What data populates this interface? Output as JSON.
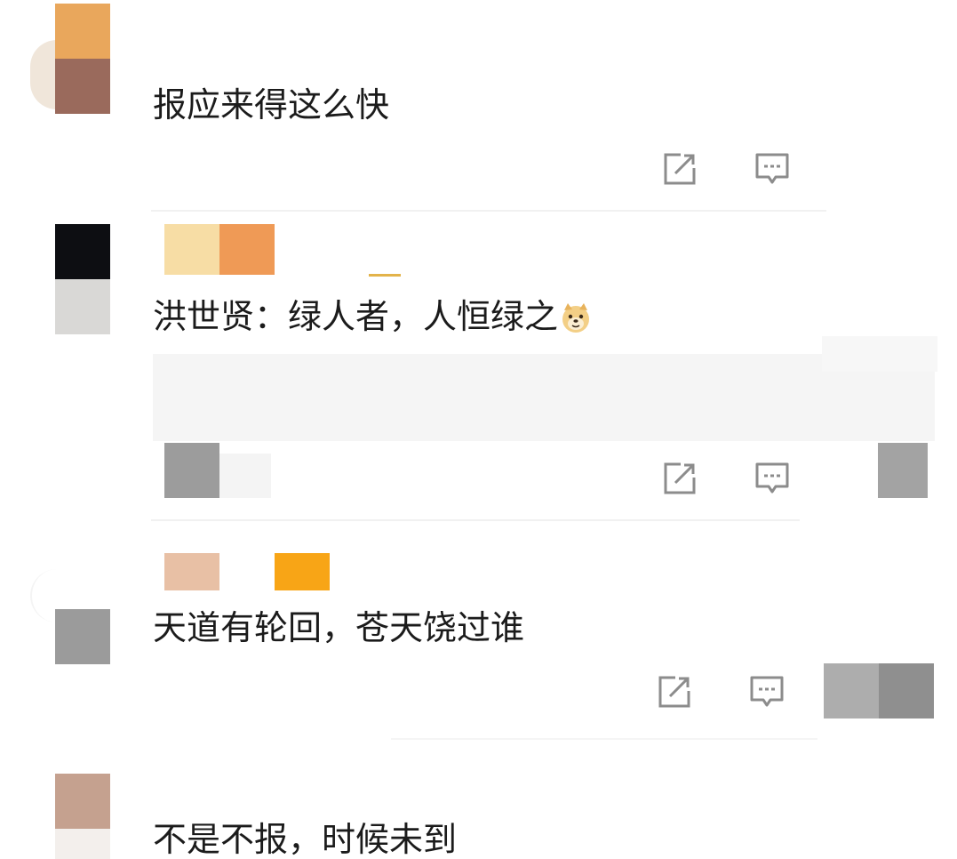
{
  "comments": [
    {
      "text": "报应来得这么快",
      "actions": {
        "share_icon": "share-icon",
        "reply_icon": "comment-icon"
      }
    },
    {
      "text": "洪世贤：绿人者，人恒绿之",
      "emoji": "doge-emoji",
      "actions": {
        "share_icon": "share-icon",
        "reply_icon": "comment-icon"
      }
    },
    {
      "text": "天道有轮回，苍天饶过谁",
      "actions": {
        "share_icon": "share-icon",
        "reply_icon": "comment-icon"
      }
    },
    {
      "text": "不是不报，时候未到"
    }
  ],
  "colors": {
    "icon_stroke": "#8c8c8c",
    "text": "#1b1b1b",
    "divider": "#f1f1f1"
  }
}
